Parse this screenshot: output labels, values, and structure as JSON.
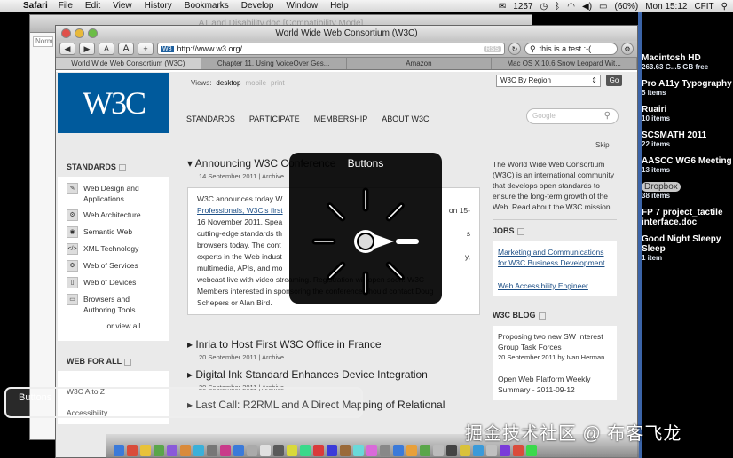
{
  "menubar": {
    "apple": "",
    "app": "Safari",
    "items": [
      "File",
      "Edit",
      "View",
      "History",
      "Bookmarks",
      "Develop",
      "Window",
      "Help"
    ],
    "mail_count": "1257",
    "battery": "(60%)",
    "clock": "Mon 15:12",
    "user": "CFIT"
  },
  "bg_window": {
    "title": "AT and Disability.doc [Compatibility Mode]",
    "style_label": "Norm"
  },
  "window": {
    "title": "World Wide Web Consortium (W3C)",
    "url": "http://www.w3.org/",
    "rss": "RSS",
    "search": "this is a test :-(",
    "zoom_small": "A",
    "zoom_large": "A",
    "tabs": [
      "World Wide Web Consortium (W3C)",
      "Chapter 11. Using VoiceOver Ges...",
      "Amazon",
      "Mac OS X 10.6 Snow Leopard Wit..."
    ]
  },
  "page": {
    "logo": "W3C",
    "views_label": "Views:",
    "views": [
      "desktop",
      "mobile",
      "print"
    ],
    "region": "W3C By Region",
    "go": "Go",
    "nav": [
      "STANDARDS",
      "PARTICIPATE",
      "MEMBERSHIP",
      "ABOUT W3C"
    ],
    "search_placeholder": "Google",
    "skip": "Skip",
    "standards_heading": "STANDARDS",
    "standards": [
      {
        "icon": "✎",
        "label": "Web Design and Applications"
      },
      {
        "icon": "⚙",
        "label": "Web Architecture"
      },
      {
        "icon": "◉",
        "label": "Semantic Web"
      },
      {
        "icon": "</>",
        "label": "XML Technology"
      },
      {
        "icon": "⚙",
        "label": "Web of Services"
      },
      {
        "icon": "▯",
        "label": "Web of Devices"
      },
      {
        "icon": "▭",
        "label": "Browsers and Authoring Tools"
      }
    ],
    "all_link": "... or view all",
    "web_for_all": "WEB FOR ALL",
    "a_to_z": "W3C A to Z",
    "accessibility": "Accessibility",
    "news": [
      {
        "title": "Announcing W3C Conference",
        "meta": "14 September 2011 | Archive"
      },
      {
        "title": "Inria to Host First W3C Office in France",
        "meta": "20 September 2011 | Archive"
      },
      {
        "title": "Digital Ink Standard Enhances Device Integration",
        "meta": "20 September 2011 | Archive"
      },
      {
        "title": "Last Call: R2RML and A Direct Mapping of Relational",
        "meta": ""
      }
    ],
    "news_box_lines": [
      "W3C announces today W",
      "Professionals, W3C's first",
      "16 November 2011. Spea",
      "cutting-edge standards th",
      "browsers today. The cont",
      "experts in the Web indust",
      "multimedia, APIs, and mo",
      "webcast live with video streaming. Registration will open soon! W3C",
      "Members interested in sponsoring the conference should contact Doug",
      "Schepers or Alan Bird."
    ],
    "news_box_tail": [
      "on 15-",
      "s",
      "y,"
    ],
    "about": "The World Wide Web Consortium (W3C) is an international community that develops open standards to ensure the long-term growth of the Web. Read about the W3C mission.",
    "jobs_heading": "JOBS",
    "jobs": [
      "Marketing and Communications for W3C Business Development",
      "Web Accessibility Engineer"
    ],
    "blog_heading": "W3C BLOG",
    "blog": [
      {
        "title": "Proposing two new SW Interest Group Task Forces",
        "meta": "20 September 2011 by Ivan Herman"
      },
      {
        "title": "Open Web Platform Weekly Summary - 2011-09-12",
        "meta": ""
      }
    ]
  },
  "rotor": {
    "title": "Buttons"
  },
  "caption": {
    "text": "Buttons"
  },
  "desktop": [
    {
      "name": "Macintosh HD",
      "sub": "263.63 G...5 GB free"
    },
    {
      "name": "Pro A11y Typography",
      "sub": "5 items"
    },
    {
      "name": "Ruairi",
      "sub": "10 items"
    },
    {
      "name": "SCSMATH 2011",
      "sub": "22 items"
    },
    {
      "name": "AASCC WG6 Meeting",
      "sub": "13 items"
    },
    {
      "name": "Dropbox",
      "sub": "38 items",
      "highlight": true
    },
    {
      "name": "FP 7 project_tactile interface.doc",
      "sub": ""
    },
    {
      "name": "Good Night Sleepy Sleep",
      "sub": "1 item"
    }
  ],
  "watermark": "掘金技术社区 @ 布客飞龙",
  "dock_colors": [
    "#3b7ad9",
    "#d94c3b",
    "#e8c23a",
    "#5aa64a",
    "#8a5ad9",
    "#d98a3b",
    "#3bb0d9",
    "#777777",
    "#c93b8a",
    "#3b7ad9",
    "#aaaaaa",
    "#e0e0e0",
    "#5a5a5a",
    "#d9d93b",
    "#3bd98a",
    "#d93b3b",
    "#3b3bd9",
    "#9a6a3a",
    "#6ad9d9",
    "#d96ad9",
    "#888888",
    "#3b7ad9",
    "#e8a03a",
    "#5aa64a",
    "#bbbbbb",
    "#444444",
    "#d9c23b",
    "#3b9ad9",
    "#c0c0c0",
    "#7a3bd9",
    "#d94c3b",
    "#3bd94c"
  ]
}
